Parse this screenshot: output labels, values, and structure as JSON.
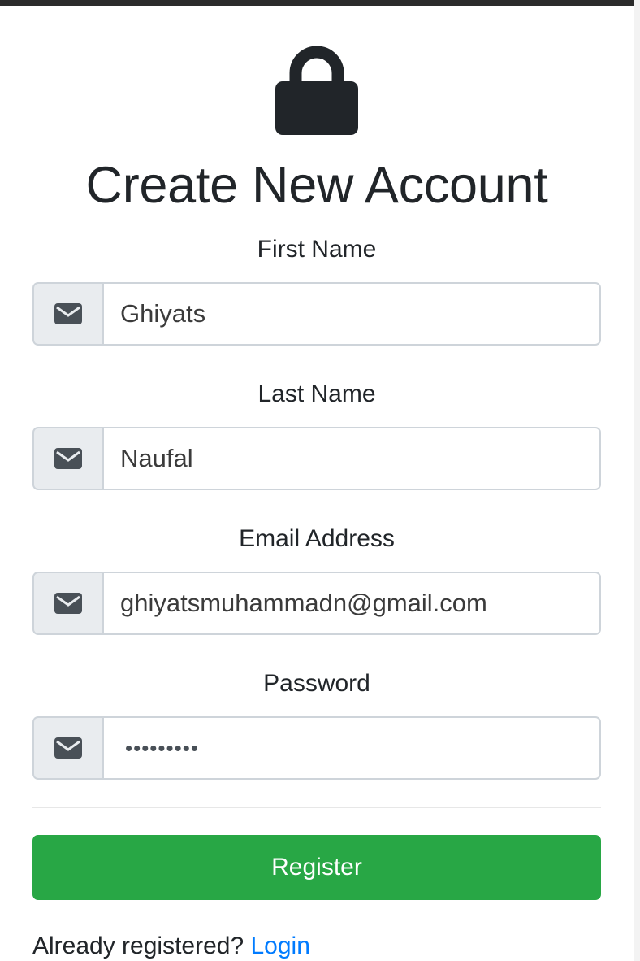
{
  "header": {
    "icon": "lock-icon",
    "title": "Create New Account"
  },
  "form": {
    "first_name": {
      "label": "First Name",
      "value": "Ghiyats",
      "icon": "envelope-icon"
    },
    "last_name": {
      "label": "Last Name",
      "value": "Naufal",
      "icon": "envelope-icon"
    },
    "email": {
      "label": "Email Address",
      "value": "ghiyatsmuhammadn@gmail.com",
      "icon": "envelope-icon"
    },
    "password": {
      "label": "Password",
      "value": "•••••••••",
      "icon": "envelope-icon"
    }
  },
  "actions": {
    "register_label": "Register"
  },
  "footer": {
    "prompt": "Already registered?",
    "login_label": "Login"
  },
  "colors": {
    "primary_button": "#28a745",
    "link": "#007bff",
    "addon_bg": "#e9ecef",
    "border": "#ced4da"
  }
}
